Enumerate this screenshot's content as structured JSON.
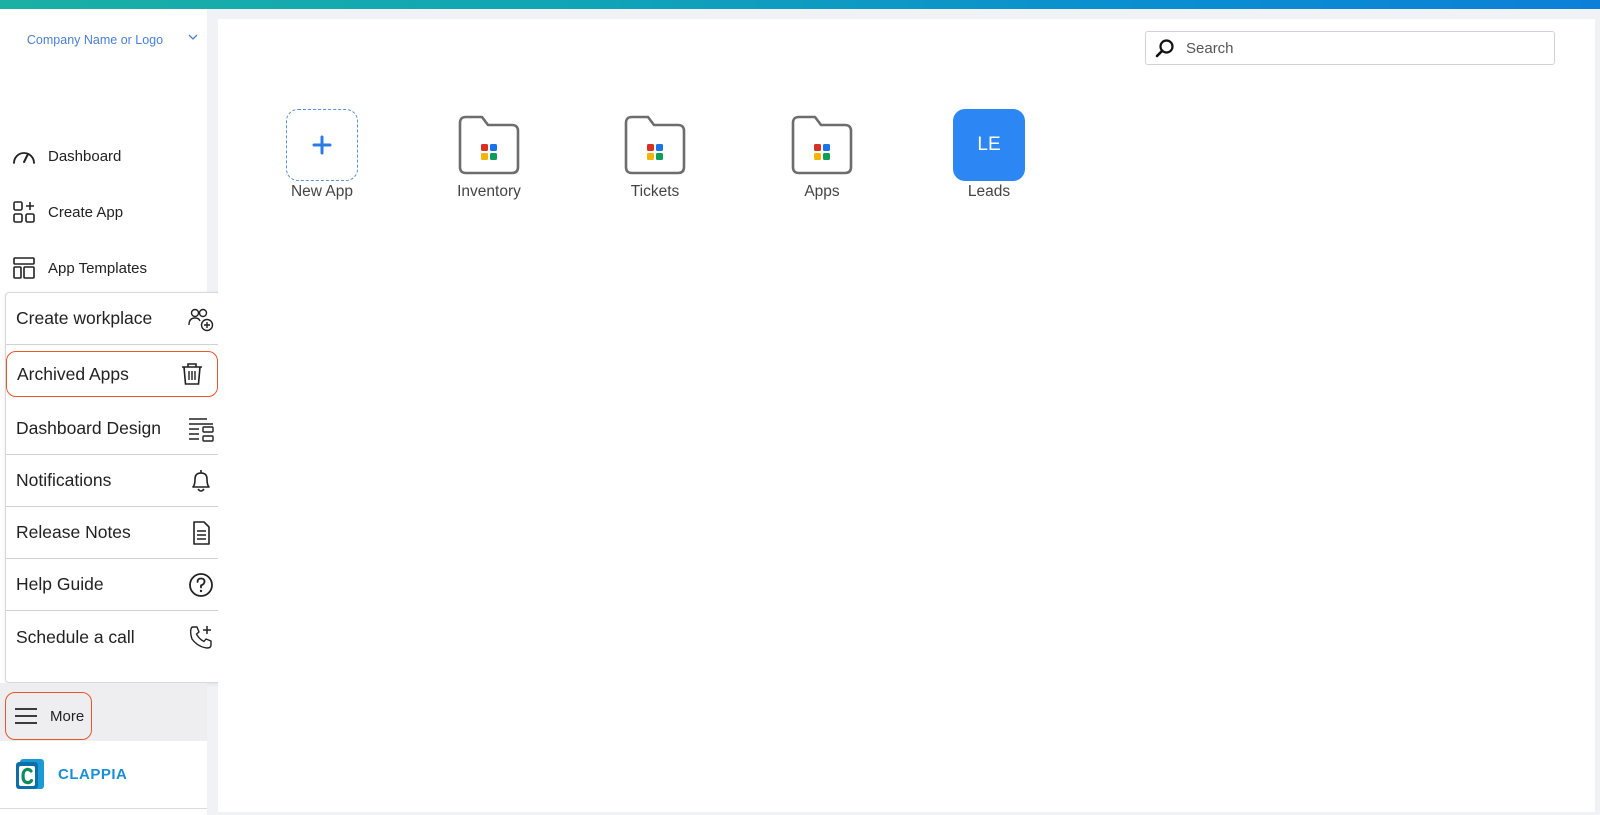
{
  "brand": {
    "text": "Company Name or Logo"
  },
  "nav": [
    {
      "label": "Dashboard",
      "icon": "speedometer-icon"
    },
    {
      "label": "Create App",
      "icon": "grid-plus-icon"
    },
    {
      "label": "App Templates",
      "icon": "layout-template-icon"
    }
  ],
  "menu": [
    {
      "label": "Create workplace",
      "icon": "users-plus-icon"
    },
    {
      "label": "Archived Apps",
      "icon": "trash-icon",
      "highlighted": true
    },
    {
      "label": "Dashboard Design",
      "icon": "layout-lines-icon"
    },
    {
      "label": "Notifications",
      "icon": "bell-icon"
    },
    {
      "label": "Release Notes",
      "icon": "document-icon"
    },
    {
      "label": "Help Guide",
      "icon": "question-circle-icon"
    },
    {
      "label": "Schedule a call",
      "icon": "phone-plus-icon"
    }
  ],
  "more": {
    "label": "More",
    "icon": "hamburger-icon",
    "highlighted": true
  },
  "footer": {
    "brand": "CLAPPIA"
  },
  "search": {
    "placeholder": "Search"
  },
  "tiles": [
    {
      "label": "New App",
      "kind": "new"
    },
    {
      "label": "Inventory",
      "kind": "folder"
    },
    {
      "label": "Tickets",
      "kind": "folder"
    },
    {
      "label": "Apps",
      "kind": "folder"
    },
    {
      "label": "Leads",
      "kind": "avatar",
      "initials": "LE"
    }
  ],
  "colors": {
    "accent": "#2c87f5",
    "highlight": "#e8562a",
    "brand_link": "#4a7fd6",
    "footer_brand": "#1a8fd6",
    "folder_dots": [
      "#d93025",
      "#1a73e8",
      "#f4b400",
      "#0f9d58"
    ]
  }
}
